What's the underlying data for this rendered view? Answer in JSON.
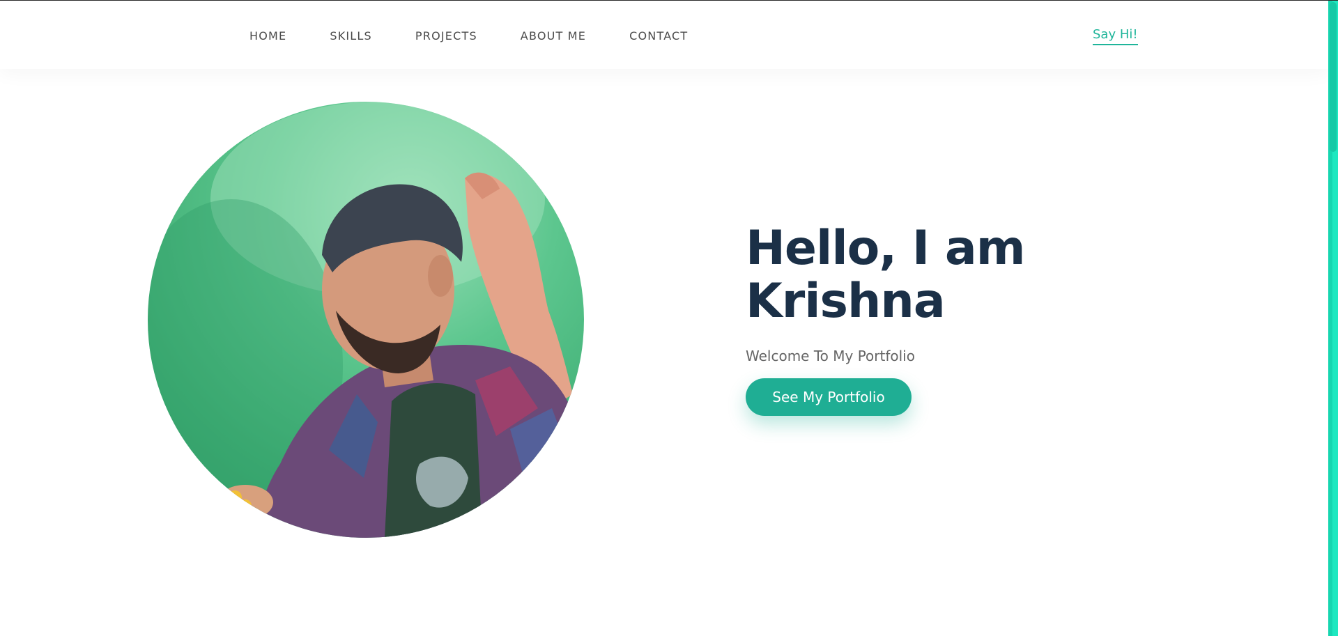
{
  "nav": {
    "items": [
      {
        "label": "HOME"
      },
      {
        "label": "SKILLS"
      },
      {
        "label": "PROJECTS"
      },
      {
        "label": "ABOUT ME"
      },
      {
        "label": "CONTACT"
      }
    ],
    "say_hi": "Say Hi!"
  },
  "hero": {
    "title_line1": "Hello, I am",
    "title_line2": "Krishna",
    "subtitle": "Welcome To My Portfolio",
    "cta_label": "See My Portfolio",
    "avatar_icon": "profile-photo-icon"
  },
  "colors": {
    "accent": "#1fae94",
    "heading": "#1b3047",
    "scrollbar": "#1ee8c0"
  }
}
